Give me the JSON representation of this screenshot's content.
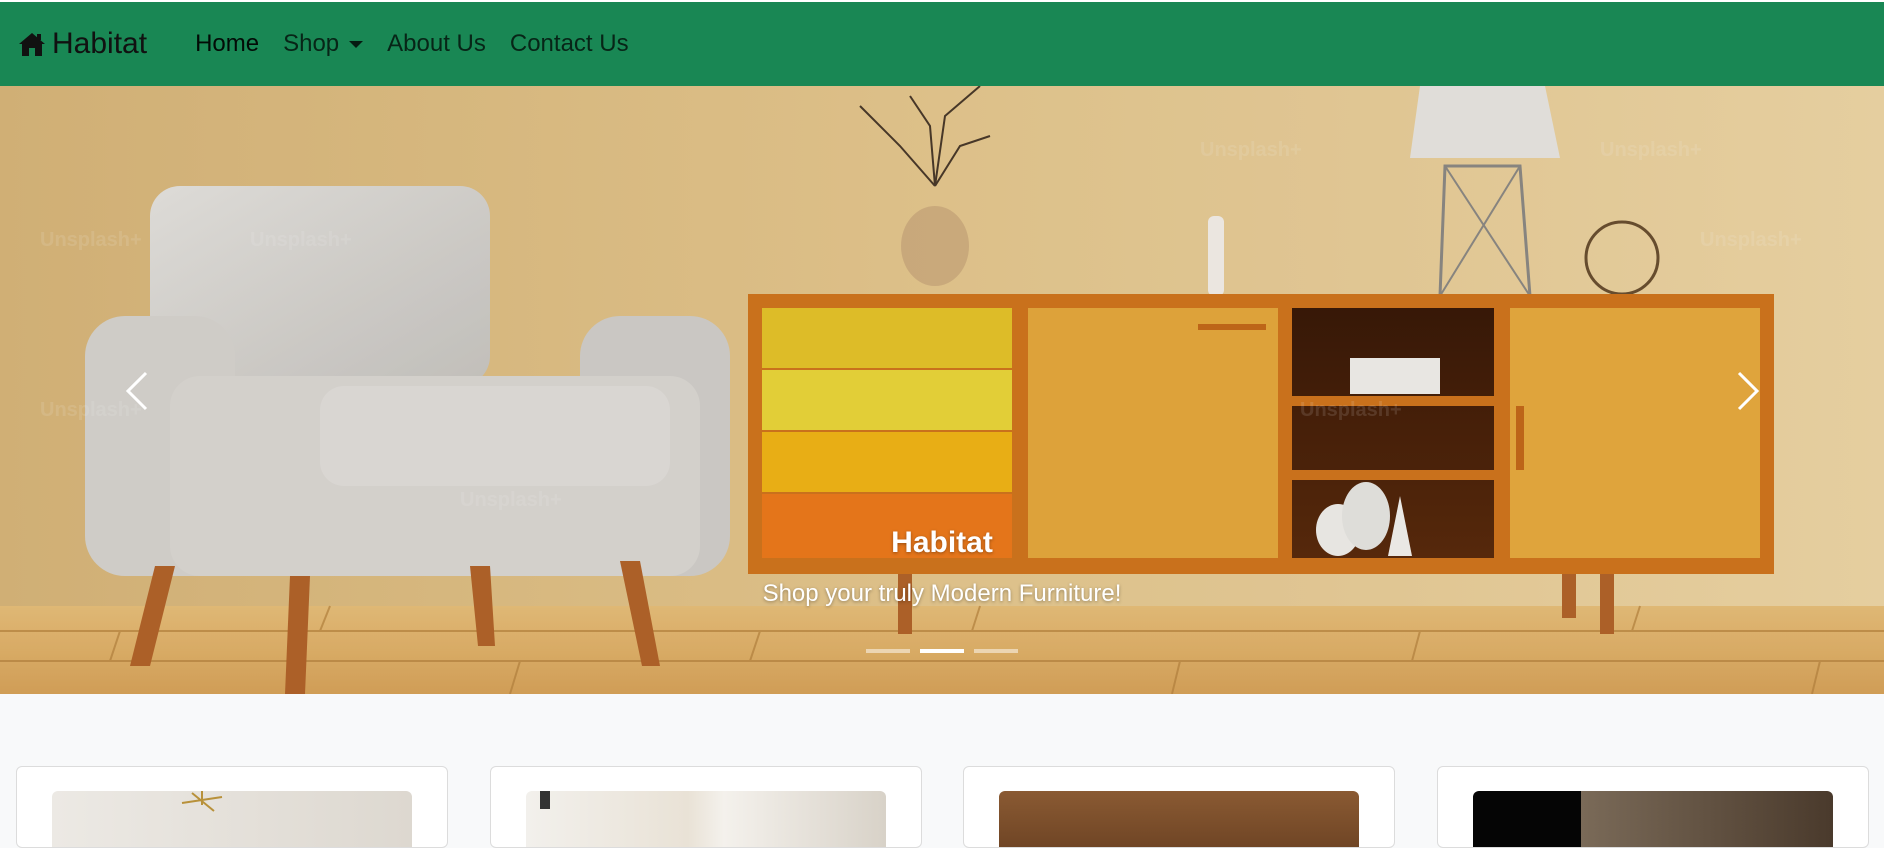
{
  "navbar": {
    "brand": "Habitat",
    "brand_icon": "home-icon",
    "items": [
      {
        "label": "Home"
      },
      {
        "label": "Shop"
      },
      {
        "label": "About Us"
      },
      {
        "label": "Contact Us"
      }
    ]
  },
  "hero": {
    "title": "Habitat",
    "subtitle": "Shop your truly Modern Furniture!",
    "active_slide": 2,
    "slide_count": 3,
    "watermark": "Unsplash+"
  },
  "colors": {
    "navbar": "#198754",
    "page_bg": "#f8f9fa",
    "wall": "#e6c78f",
    "cabinet": "#e8a33a"
  },
  "cards": [
    {
      "image": "lamp-room-photo"
    },
    {
      "image": "curtain-room-photo"
    },
    {
      "image": "sofa-photo"
    },
    {
      "image": "dark-interior-photo"
    }
  ]
}
